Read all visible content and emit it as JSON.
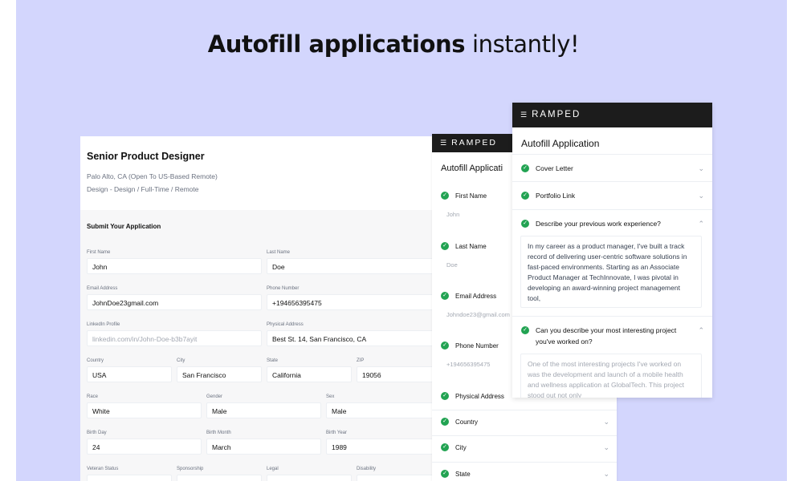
{
  "headline": {
    "bold": "Autofill applications",
    "rest": " instantly!"
  },
  "job": {
    "title": "Senior Product Designer",
    "location": "Palo Alto, CA (Open To US-Based Remote)",
    "category": "Design - Design / Full-Time / Remote",
    "submit_title": "Submit Your Application",
    "fields": {
      "first_name": {
        "label": "First Name",
        "value": "John"
      },
      "last_name": {
        "label": "Last Name",
        "value": "Doe"
      },
      "email": {
        "label": "Email Address",
        "value": "JohnDoe23gmail.com"
      },
      "phone": {
        "label": "Phone Number",
        "value": "+194656395475"
      },
      "linkedin": {
        "label": "LinkedIn Profile",
        "value": "linkedin.com/in/John-Doe-b3b7ayit"
      },
      "address": {
        "label": "Physical Address",
        "value": "Best St. 14, San Francisco, CA"
      },
      "country": {
        "label": "Country",
        "value": "USA"
      },
      "city": {
        "label": "City",
        "value": "San Francisco"
      },
      "state": {
        "label": "State",
        "value": "California"
      },
      "zip": {
        "label": "ZIP",
        "value": "19056"
      },
      "race": {
        "label": "Race",
        "value": "White"
      },
      "gender": {
        "label": "Gender",
        "value": "Male"
      },
      "sex": {
        "label": "Sex",
        "value": "Male"
      },
      "birth_day": {
        "label": "Birth Day",
        "value": "24"
      },
      "birth_month": {
        "label": "Birth Month",
        "value": "March"
      },
      "birth_year": {
        "label": "Birth Year",
        "value": "1989"
      },
      "veteran": {
        "label": "Veteran Status"
      },
      "sponsorship": {
        "label": "Sponsorship"
      },
      "legal": {
        "label": "Legal"
      },
      "disability": {
        "label": "Disability"
      }
    }
  },
  "mid_panel": {
    "brand": "RAMPED",
    "title": "Autofill Applicati",
    "items": [
      {
        "label": "First Name",
        "value": "John"
      },
      {
        "label": "Last Name",
        "value": "Doe"
      },
      {
        "label": "Email Address",
        "value": "Johndoe23@gmail.com"
      },
      {
        "label": "Phone Number",
        "value": "+194656395475"
      },
      {
        "label": "Physical Address"
      },
      {
        "label": "Country"
      },
      {
        "label": "City"
      },
      {
        "label": "State"
      }
    ]
  },
  "right_panel": {
    "brand": "RAMPED",
    "title": "Autofill Application",
    "items": [
      {
        "label": "Cover Letter"
      },
      {
        "label": "Portfolio Link"
      },
      {
        "label": "Describe your previous work experience?",
        "answer": "In my career as a product manager, I've built a track record of delivering user-centric software solutions in fast-paced environments. Starting as an Associate Product Manager at TechInnovate, I was pivotal in developing an award-winning project management tool,"
      },
      {
        "label": "Can you describe your most interesting project you've worked on?",
        "answer": "One of the most interesting projects I've worked on was the development and launch of a mobile health and wellness application at GlobalTech. This project stood out not only"
      }
    ]
  },
  "colors": {
    "background": "#d3d6fd",
    "check": "#22a352",
    "brandbar": "#1c1c1c"
  },
  "icons": {
    "check": "check-circle-icon",
    "chevron": "chevron-down-icon",
    "logo": "ramped-logo-icon"
  }
}
